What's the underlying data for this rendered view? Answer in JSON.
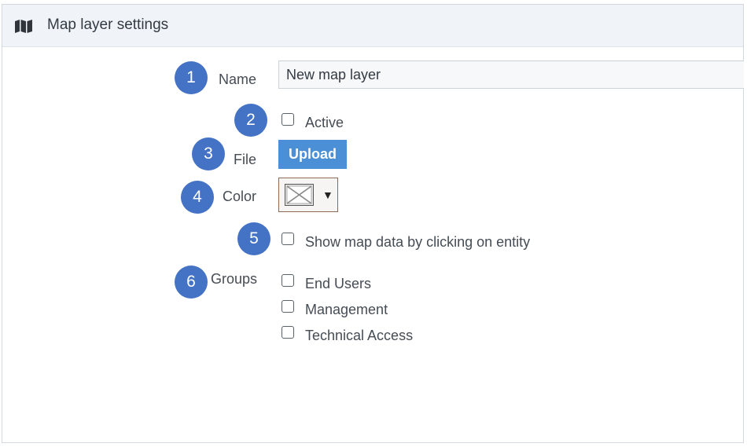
{
  "header": {
    "title": "Map layer settings",
    "icon": "map-icon"
  },
  "badges": [
    "1",
    "2",
    "3",
    "4",
    "5",
    "6"
  ],
  "form": {
    "name": {
      "label": "Name",
      "value": "New map layer"
    },
    "active": {
      "label": "Active",
      "checked": false
    },
    "file": {
      "label": "File",
      "button_label": "Upload"
    },
    "color": {
      "label": "Color",
      "caret": "▼",
      "value": "none"
    },
    "show_map_data": {
      "label": "Show map data by clicking on entity",
      "checked": false
    },
    "groups": {
      "label": "Groups",
      "items": [
        {
          "label": "End Users",
          "checked": false
        },
        {
          "label": "Management",
          "checked": false
        },
        {
          "label": "Technical Access",
          "checked": false
        }
      ]
    }
  },
  "colors": {
    "badge": "#4472c4",
    "upload_button": "#4b8fd6",
    "header_bg": "#f0f4f8"
  }
}
